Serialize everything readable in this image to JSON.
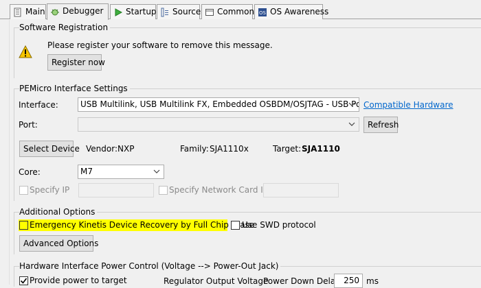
{
  "tabs": [
    {
      "label": "Main",
      "icon": "main-icon"
    },
    {
      "label": "Debugger",
      "icon": "debugger-icon",
      "active": true
    },
    {
      "label": "Startup",
      "icon": "startup-icon"
    },
    {
      "label": "Source",
      "icon": "source-icon"
    },
    {
      "label": "Common",
      "icon": "common-icon"
    },
    {
      "label": "OS Awareness",
      "icon": "os-awareness-icon"
    }
  ],
  "software_registration": {
    "title": "Software Registration",
    "message": "Please register your software to remove this message.",
    "register_button": "Register now",
    "icon": "warning-icon"
  },
  "interface_settings": {
    "title": "PEMicro Interface Settings",
    "interface_label": "Interface:",
    "interface_value": "USB Multilink, USB Multilink FX, Embedded OSBDM/OSJTAG - USB Port",
    "compatible_hardware_link": "Compatible Hardware",
    "port_label": "Port:",
    "port_value": "",
    "refresh_button": "Refresh",
    "select_device_button": "Select Device",
    "vendor_label": "Vendor:",
    "vendor_value": "NXP",
    "family_label": "Family:",
    "family_value": "SJA1110x",
    "target_label": "Target:",
    "target_value": "SJA1110",
    "core_label": "Core:",
    "core_value": "M7",
    "specify_ip_label": "Specify IP",
    "specify_network_card_ip_label": "Specify Network Card IP"
  },
  "additional_options": {
    "title": "Additional Options",
    "emergency_kinetis_label": "Emergency Kinetis Device Recovery by Full Chip Erase",
    "use_swd_label": "Use SWD protocol",
    "advanced_options_button": "Advanced Options"
  },
  "power_control": {
    "title": "Hardware Interface Power Control (Voltage --> Power-Out Jack)",
    "provide_power_label": "Provide power to target",
    "provide_power_checked": true,
    "regulator_output_label": "Regulator Output Voltage",
    "power_down_delay_label": "Power Down Delay",
    "power_down_delay_value": "250",
    "power_down_delay_unit": "ms"
  },
  "colors": {
    "highlight": "#ffff00",
    "link": "#0066cc",
    "warning": "#f7c500"
  }
}
